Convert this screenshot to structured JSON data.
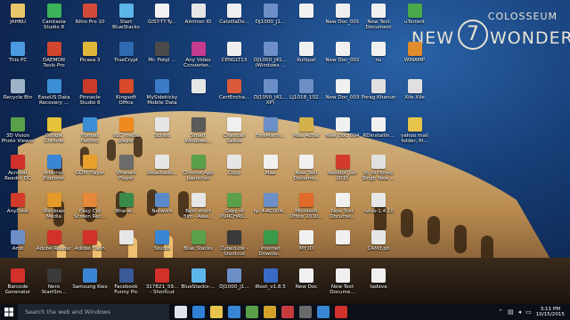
{
  "brand": {
    "top": "COLOSSEUM",
    "new": "NEW",
    "seven": "7",
    "wonders": "WONDERS"
  },
  "icons": [
    {
      "label": "JAHNU",
      "color": "#e8c66a",
      "col": 0,
      "row": 0
    },
    {
      "label": "Camtasia Studio 8",
      "color": "#3bb35a",
      "col": 1,
      "row": 0
    },
    {
      "label": "Nitro Pro 10",
      "color": "#d24a3a",
      "col": 2,
      "row": 0
    },
    {
      "label": "Start BlueStacks",
      "color": "#5cb6ea",
      "col": 3,
      "row": 0
    },
    {
      "label": "GIST-TT-Ty...",
      "color": "#f2f2f2",
      "col": 4,
      "row": 0
    },
    {
      "label": "Aimtron ID",
      "color": "#e6e6e6",
      "col": 5,
      "row": 0
    },
    {
      "label": "CatzillaDo...",
      "color": "#f0f0f0",
      "col": 6,
      "row": 0
    },
    {
      "label": "DJ1000_J1...",
      "color": "#6c8fc8",
      "col": 7,
      "row": 0
    },
    {
      "label": "",
      "color": "#f0f0f0",
      "col": 8,
      "row": 0
    },
    {
      "label": "New Doc_001",
      "color": "#f0f0f0",
      "col": 9,
      "row": 0
    },
    {
      "label": "New Text Document",
      "color": "#f0f0f0",
      "col": 10,
      "row": 0
    },
    {
      "label": "uTorrent",
      "color": "#4aa84a",
      "col": 11,
      "row": 0
    },
    {
      "label": "This PC",
      "color": "#4c9ae0",
      "col": 0,
      "row": 1
    },
    {
      "label": "DAEMON Tools Pro",
      "color": "#d2452f",
      "col": 1,
      "row": 1
    },
    {
      "label": "Picasa 3",
      "color": "#e1b73a",
      "col": 2,
      "row": 1
    },
    {
      "label": "TrueCrypt",
      "color": "#2f6ab0",
      "col": 3,
      "row": 1
    },
    {
      "label": "Mr. Potpl ...",
      "color": "#4a4a4a",
      "col": 4,
      "row": 1
    },
    {
      "label": "Any Video Converter...",
      "color": "#c63c8e",
      "col": 5,
      "row": 1
    },
    {
      "label": "CENGLT13",
      "color": "#eeeeee",
      "col": 6,
      "row": 1
    },
    {
      "label": "DJ1050_J41... (Windows ...",
      "color": "#6c8fc8",
      "col": 7,
      "row": 1
    },
    {
      "label": "Kuhipat",
      "color": "#f0f0f0",
      "col": 8,
      "row": 1
    },
    {
      "label": "New Doc_002",
      "color": "#f0f0f0",
      "col": 9,
      "row": 1
    },
    {
      "label": "nu",
      "color": "#f0f0f0",
      "col": 10,
      "row": 1
    },
    {
      "label": "WINAMP",
      "color": "#e08b2c",
      "col": 11,
      "row": 1
    },
    {
      "label": "Recycle Bin",
      "color": "#9fb3c8",
      "col": 0,
      "row": 2
    },
    {
      "label": "EaseUS Data Recovery ...",
      "color": "#3c8fd4",
      "col": 1,
      "row": 2
    },
    {
      "label": "Pinnacle Studio 8",
      "color": "#cc3a2a",
      "col": 2,
      "row": 2
    },
    {
      "label": "Kingsoft Office",
      "color": "#d84a2a",
      "col": 3,
      "row": 2
    },
    {
      "label": "MySidekicky Mobile Data",
      "color": "#3b7ac4",
      "col": 4,
      "row": 2
    },
    {
      "label": "",
      "color": "#e6e6e6",
      "col": 5,
      "row": 2
    },
    {
      "label": "CertEncha...",
      "color": "#d95a3a",
      "col": 6,
      "row": 2
    },
    {
      "label": "DJ1050_J41... XP)",
      "color": "#6c8fc8",
      "col": 7,
      "row": 2
    },
    {
      "label": "LJ1018_102...",
      "color": "#6c8fc8",
      "col": 8,
      "row": 2
    },
    {
      "label": "New Doc_003",
      "color": "#f0f0f0",
      "col": 9,
      "row": 2
    },
    {
      "label": "Porag Khanun",
      "color": "#e0e0e0",
      "col": 10,
      "row": 2
    },
    {
      "label": "Xile Xile",
      "color": "#e0e0e0",
      "col": 11,
      "row": 2
    },
    {
      "label": "3D Vision Photo Viewer",
      "color": "#5aa04a",
      "col": 0,
      "row": 3
    },
    {
      "label": "Google Chrome",
      "color": "#e5c23a",
      "col": 1,
      "row": 3
    },
    {
      "label": "Format Factory",
      "color": "#3c8fd4",
      "col": 2,
      "row": 3
    },
    {
      "label": "VLC media player",
      "color": "#f08a1e",
      "col": 3,
      "row": 3
    },
    {
      "label": "Scribo",
      "color": "#e6e6e6",
      "col": 4,
      "row": 3
    },
    {
      "label": "Smart Windows...",
      "color": "#5a5a5a",
      "col": 5,
      "row": 3
    },
    {
      "label": "Chandan Saikia",
      "color": "#f0f0f0",
      "col": 6,
      "row": 3
    },
    {
      "label": "FreeMarm...",
      "color": "#6c8fc8",
      "col": 7,
      "row": 3
    },
    {
      "label": "Maa Adhar",
      "color": "#d4b24a",
      "col": 8,
      "row": 3
    },
    {
      "label": "New Doc_004",
      "color": "#f0f0f0",
      "col": 9,
      "row": 3
    },
    {
      "label": "RDinstallin...",
      "color": "#f0f0f0",
      "col": 10,
      "row": 3
    },
    {
      "label": "yahoo mail folder, fil...",
      "color": "#e6c44a",
      "col": 11,
      "row": 3
    },
    {
      "label": "Acrobat Reader DC",
      "color": "#d2302a",
      "col": 0,
      "row": 4
    },
    {
      "label": "Internet Explorer",
      "color": "#3a86d4",
      "col": 1,
      "row": 4
    },
    {
      "label": "GOM Player",
      "color": "#e8a02c",
      "col": 2,
      "row": 4
    },
    {
      "label": "VMware Player",
      "color": "#6b6b6b",
      "col": 3,
      "row": 4
    },
    {
      "label": "bikashado...",
      "color": "#e6e6e6",
      "col": 4,
      "row": 4
    },
    {
      "label": "Chrome App Launcher",
      "color": "#5aa04a",
      "col": 5,
      "row": 4
    },
    {
      "label": "Copy",
      "color": "#e6e6e6",
      "col": 6,
      "row": 4
    },
    {
      "label": "Maa",
      "color": "#f0f0f0",
      "col": 7,
      "row": 4
    },
    {
      "label": "New Text Docume...",
      "color": "#f0f0f0",
      "col": 8,
      "row": 4
    },
    {
      "label": "Receipt_Jun 2015",
      "color": "#d43a2a",
      "col": 9,
      "row": 4
    },
    {
      "label": "Yo Yo Honey Singh New ...",
      "color": "#e0e0e0",
      "col": 10,
      "row": 4
    },
    {
      "label": "AnyDesk",
      "color": "#d23a2a",
      "col": 0,
      "row": 5
    },
    {
      "label": "Windows Media",
      "color": "#e59a2a",
      "col": 1,
      "row": 5
    },
    {
      "label": "Easy Cut Screen Rec...",
      "color": "#e5883a",
      "col": 2,
      "row": 5
    },
    {
      "label": "Bharat...",
      "color": "#3a8a4a",
      "col": 3,
      "row": 5
    },
    {
      "label": "Network",
      "color": "#5a8ac8",
      "col": 4,
      "row": 5
    },
    {
      "label": "Best short film - Awa...",
      "color": "#e6e6e6",
      "col": 5,
      "row": 5
    },
    {
      "label": "Copy of PURCHAS...",
      "color": "#5aa04a",
      "col": 6,
      "row": 5
    },
    {
      "label": "hp 4-AC004...",
      "color": "#6c8fc8",
      "col": 7,
      "row": 5
    },
    {
      "label": "Microsoft Office 2010...",
      "color": "#e06a2a",
      "col": 8,
      "row": 5
    },
    {
      "label": "New Text Docume...",
      "color": "#f0f0f0",
      "col": 9,
      "row": 5
    },
    {
      "label": "rufus-1.4.10",
      "color": "#e6e6e6",
      "col": 10,
      "row": 5
    },
    {
      "label": "Amb",
      "color": "#6c8fc8",
      "col": 0,
      "row": 6
    },
    {
      "label": "Adobe Reader",
      "color": "#d2302a",
      "col": 1,
      "row": 6
    },
    {
      "label": "Adobe Flash",
      "color": "#d2302a",
      "col": 2,
      "row": 6
    },
    {
      "label": "",
      "color": "#e6e6e6",
      "col": 3,
      "row": 6
    },
    {
      "label": "Studio",
      "color": "#3a86d4",
      "col": 4,
      "row": 6
    },
    {
      "label": "Blue Stacks",
      "color": "#5aa04a",
      "col": 5,
      "row": 6
    },
    {
      "label": "CyberLink - Shortcut",
      "color": "#3a3a3a",
      "col": 6,
      "row": 6
    },
    {
      "label": "Internet Downlo...",
      "color": "#3a9a4a",
      "col": 7,
      "row": 6
    },
    {
      "label": "MY ID",
      "color": "#f0f0f0",
      "col": 8,
      "row": 6
    },
    {
      "label": "",
      "color": "#f0f0f0",
      "col": 9,
      "row": 6
    },
    {
      "label": "CAM3.pb",
      "color": "#e6e6e6",
      "col": 10,
      "row": 6
    },
    {
      "label": "Barcode Generator",
      "color": "#d2302a",
      "col": 0,
      "row": 7
    },
    {
      "label": "Nero StartSm...",
      "color": "#3a3a3a",
      "col": 1,
      "row": 7
    },
    {
      "label": "Samsung Kies",
      "color": "#3a86d4",
      "col": 2,
      "row": 7
    },
    {
      "label": "Facebook Funny Pic",
      "color": "#3a5a98",
      "col": 3,
      "row": 7
    },
    {
      "label": "317821_59... - Shortcut",
      "color": "#d2302a",
      "col": 4,
      "row": 7
    },
    {
      "label": "BlueStacks-...",
      "color": "#5cb6ea",
      "col": 5,
      "row": 7
    },
    {
      "label": "DJ1000_J1...",
      "color": "#6c8fc8",
      "col": 6,
      "row": 7
    },
    {
      "label": "iRoot_v1.8.5",
      "color": "#3a6ac8",
      "col": 7,
      "row": 7
    },
    {
      "label": "New Doc",
      "color": "#f0f0f0",
      "col": 8,
      "row": 7
    },
    {
      "label": "New Text Docume...",
      "color": "#f0f0f0",
      "col": 9,
      "row": 7
    },
    {
      "label": "tadeve",
      "color": "#f0f0f0",
      "col": 10,
      "row": 7
    }
  ],
  "taskbar": {
    "search_placeholder": "Search the web and Windows",
    "apps": [
      {
        "name": "task-view",
        "color": "#dfe3ea"
      },
      {
        "name": "edge",
        "color": "#2f7fd6"
      },
      {
        "name": "file-explorer",
        "color": "#e8c44a"
      },
      {
        "name": "store",
        "color": "#3a86d4"
      },
      {
        "name": "chrome",
        "color": "#5aa04a"
      },
      {
        "name": "photos",
        "color": "#d4a22a"
      },
      {
        "name": "media",
        "color": "#c63c3c"
      },
      {
        "name": "app-8",
        "color": "#6a6a6a"
      },
      {
        "name": "app-9",
        "color": "#3a86d4"
      },
      {
        "name": "app-10",
        "color": "#d2302a"
      }
    ],
    "time": "3:11 PM",
    "date": "10/15/2015"
  }
}
